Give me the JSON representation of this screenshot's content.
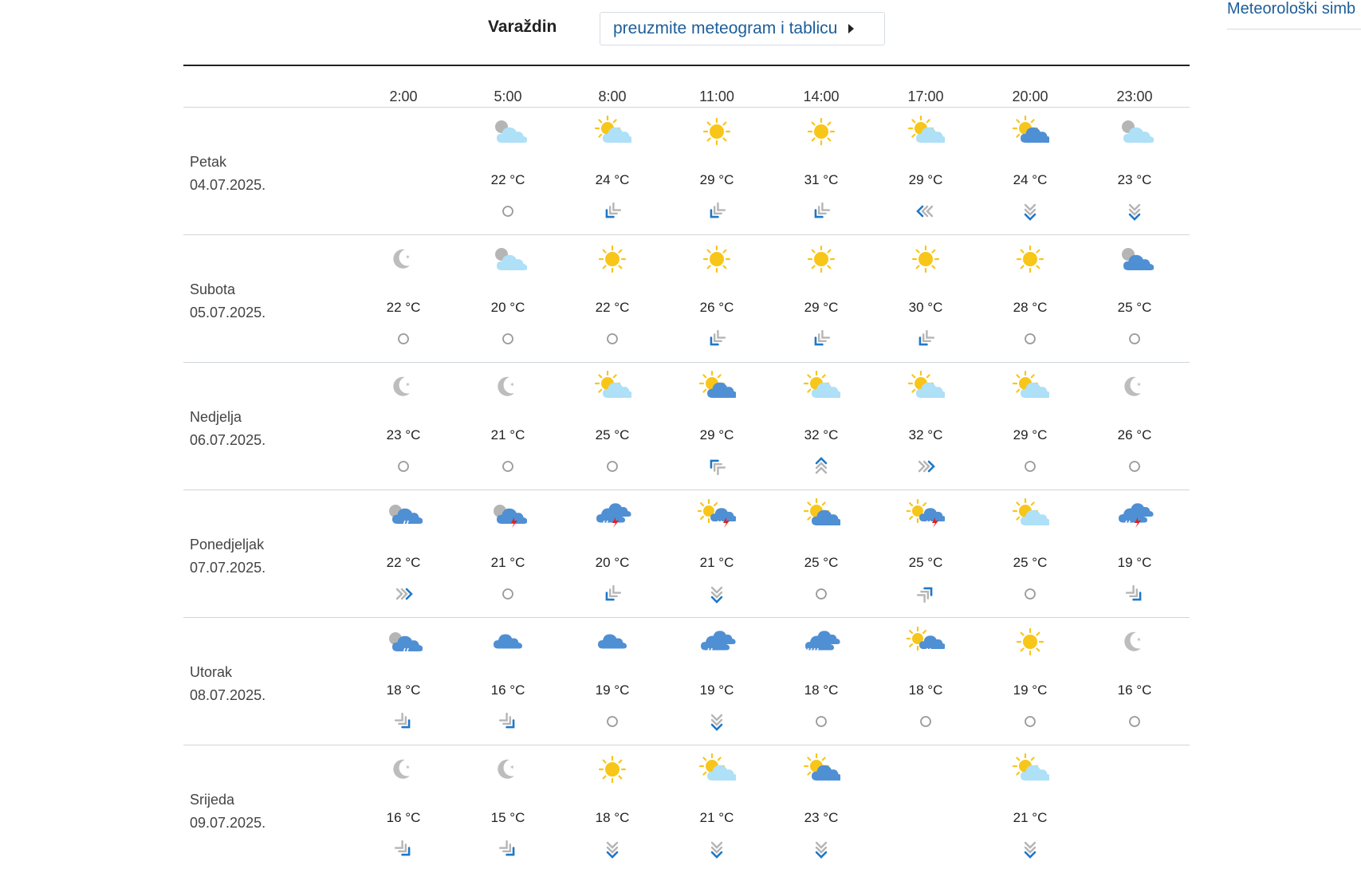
{
  "header": {
    "city": "Varaždin",
    "meteogram_button": "preuzmite meteogram i tablicu",
    "side_link": "Meteorološki simb"
  },
  "colors": {
    "link": "#1d5e9a",
    "sun": "#f7c619",
    "cloud_light": "#aee0f7",
    "cloud_dark": "#4f8fd4",
    "lightning": "#e02020",
    "wind_blue": "#1f78c8"
  },
  "times": [
    "2:00",
    "5:00",
    "8:00",
    "11:00",
    "14:00",
    "17:00",
    "20:00",
    "23:00"
  ],
  "days": [
    {
      "name": "Petak",
      "date": "04.07.2025.",
      "cells": [
        null,
        {
          "icon": "night-partly-cloudy-icon",
          "temp": "22 °C",
          "wind": "calm"
        },
        {
          "icon": "sun-light-cloud-icon",
          "temp": "24 °C",
          "wind": "sw"
        },
        {
          "icon": "sun-icon",
          "temp": "29 °C",
          "wind": "sw"
        },
        {
          "icon": "sun-icon",
          "temp": "31 °C",
          "wind": "sw"
        },
        {
          "icon": "sun-light-cloud-icon",
          "temp": "29 °C",
          "wind": "w"
        },
        {
          "icon": "sun-dark-cloud-icon",
          "temp": "24 °C",
          "wind": "s"
        },
        {
          "icon": "night-partly-cloudy-icon",
          "temp": "23 °C",
          "wind": "s"
        }
      ]
    },
    {
      "name": "Subota",
      "date": "05.07.2025.",
      "cells": [
        {
          "icon": "moon-icon",
          "temp": "22 °C",
          "wind": "calm"
        },
        {
          "icon": "night-partly-cloudy-icon",
          "temp": "20 °C",
          "wind": "calm"
        },
        {
          "icon": "sun-icon",
          "temp": "22 °C",
          "wind": "calm"
        },
        {
          "icon": "sun-icon",
          "temp": "26 °C",
          "wind": "sw"
        },
        {
          "icon": "sun-icon",
          "temp": "29 °C",
          "wind": "sw"
        },
        {
          "icon": "sun-icon",
          "temp": "30 °C",
          "wind": "sw"
        },
        {
          "icon": "sun-icon",
          "temp": "28 °C",
          "wind": "calm"
        },
        {
          "icon": "night-dark-cloud-icon",
          "temp": "25 °C",
          "wind": "calm"
        }
      ]
    },
    {
      "name": "Nedjelja",
      "date": "06.07.2025.",
      "cells": [
        {
          "icon": "moon-icon",
          "temp": "23 °C",
          "wind": "calm"
        },
        {
          "icon": "moon-icon",
          "temp": "21 °C",
          "wind": "calm"
        },
        {
          "icon": "sun-light-cloud-icon",
          "temp": "25 °C",
          "wind": "calm"
        },
        {
          "icon": "sun-dark-cloud-icon",
          "temp": "29 °C",
          "wind": "nw"
        },
        {
          "icon": "sun-light-cloud-icon",
          "temp": "32 °C",
          "wind": "n"
        },
        {
          "icon": "sun-light-cloud-icon",
          "temp": "32 °C",
          "wind": "e"
        },
        {
          "icon": "sun-light-cloud-icon",
          "temp": "29 °C",
          "wind": "calm"
        },
        {
          "icon": "moon-icon",
          "temp": "26 °C",
          "wind": "calm"
        }
      ]
    },
    {
      "name": "Ponedjeljak",
      "date": "07.07.2025.",
      "cells": [
        {
          "icon": "night-rain-icon",
          "temp": "22 °C",
          "wind": "e"
        },
        {
          "icon": "night-thunderstorm-icon",
          "temp": "21 °C",
          "wind": "calm"
        },
        {
          "icon": "thunderstorm-icon",
          "temp": "20 °C",
          "wind": "sw"
        },
        {
          "icon": "sun-thunderstorm-icon",
          "temp": "21 °C",
          "wind": "s"
        },
        {
          "icon": "sun-dark-cloud-icon",
          "temp": "25 °C",
          "wind": "calm"
        },
        {
          "icon": "sun-thunderstorm-icon",
          "temp": "25 °C",
          "wind": "ne"
        },
        {
          "icon": "sun-light-cloud-icon",
          "temp": "25 °C",
          "wind": "calm"
        },
        {
          "icon": "thunderstorm-icon",
          "temp": "19 °C",
          "wind": "se"
        }
      ]
    },
    {
      "name": "Utorak",
      "date": "08.07.2025.",
      "cells": [
        {
          "icon": "night-rain-icon",
          "temp": "18 °C",
          "wind": "se"
        },
        {
          "icon": "cloud-icon",
          "temp": "16 °C",
          "wind": "se"
        },
        {
          "icon": "cloud-icon",
          "temp": "19 °C",
          "wind": "calm"
        },
        {
          "icon": "rain-icon",
          "temp": "19 °C",
          "wind": "s"
        },
        {
          "icon": "heavy-rain-icon",
          "temp": "18 °C",
          "wind": "calm"
        },
        {
          "icon": "sun-rain-icon",
          "temp": "18 °C",
          "wind": "calm"
        },
        {
          "icon": "sun-icon",
          "temp": "19 °C",
          "wind": "calm"
        },
        {
          "icon": "moon-icon",
          "temp": "16 °C",
          "wind": "calm"
        }
      ]
    },
    {
      "name": "Srijeda",
      "date": "09.07.2025.",
      "cells": [
        {
          "icon": "moon-icon",
          "temp": "16 °C",
          "wind": "se"
        },
        {
          "icon": "moon-icon",
          "temp": "15 °C",
          "wind": "se"
        },
        {
          "icon": "sun-icon",
          "temp": "18 °C",
          "wind": "s"
        },
        {
          "icon": "sun-light-cloud-icon",
          "temp": "21 °C",
          "wind": "s"
        },
        {
          "icon": "sun-dark-cloud-icon",
          "temp": "23 °C",
          "wind": "s"
        },
        null,
        {
          "icon": "sun-light-cloud-icon",
          "temp": "21 °C",
          "wind": "s"
        },
        null
      ]
    }
  ]
}
